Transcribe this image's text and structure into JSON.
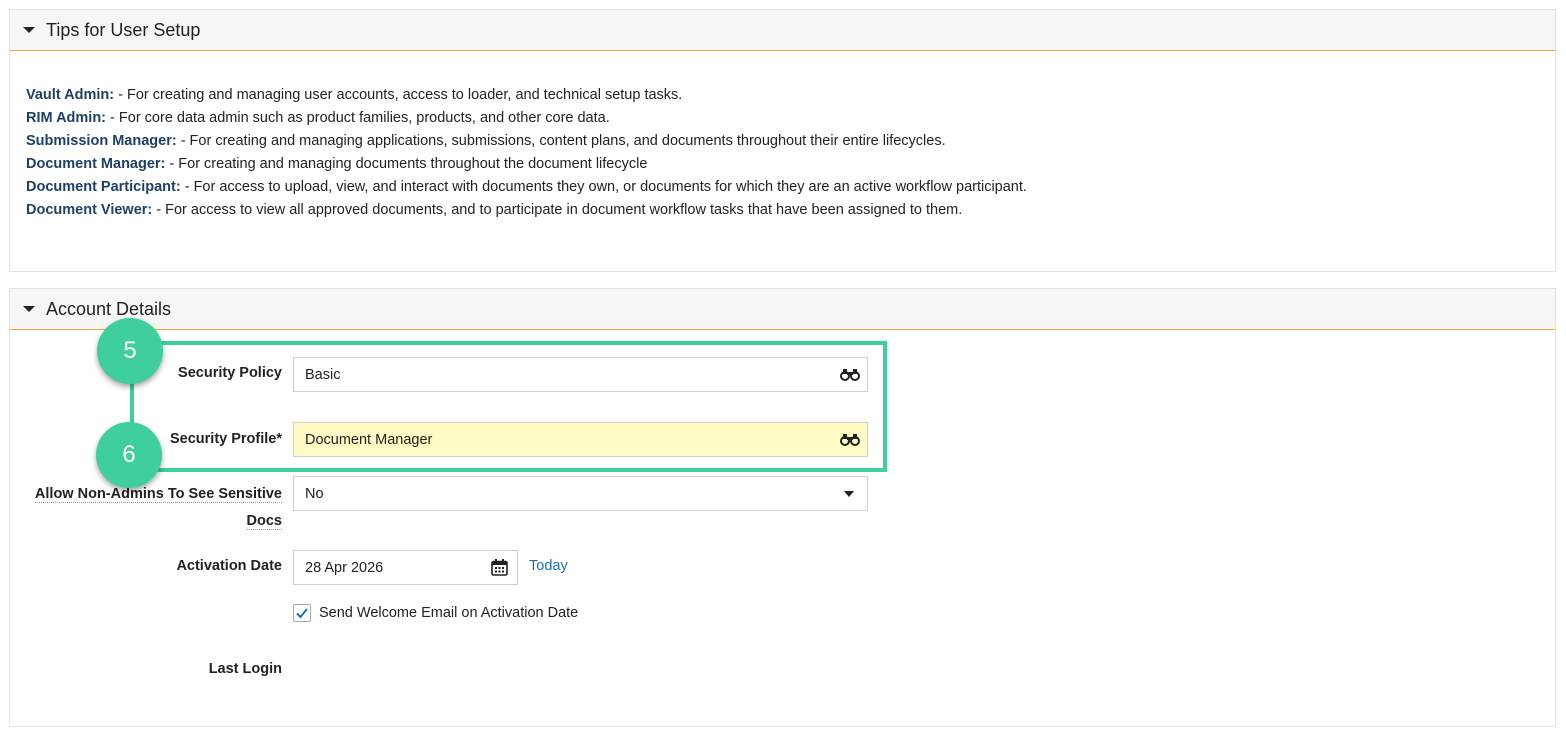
{
  "tips_panel": {
    "title": "Tips for User Setup",
    "lines": [
      {
        "role": "Vault Admin:",
        "text": " - For creating and managing user accounts, access to loader, and technical setup tasks."
      },
      {
        "role": "RIM Admin:",
        "text": " - For core data admin such as product families, products, and other core data."
      },
      {
        "role": "Submission Manager:",
        "text": " - For creating and managing applications, submissions, content plans, and documents throughout their entire lifecycles."
      },
      {
        "role": "Document Manager:",
        "text": " - For creating and managing documents throughout the document lifecycle"
      },
      {
        "role": "Document Participant:",
        "text": " - For access to upload, view, and interact with documents they own, or documents for which they are an active workflow participant."
      },
      {
        "role": "Document Viewer:",
        "text": " - For access to view all approved documents, and to participate in document workflow tasks that have been assigned to them."
      }
    ]
  },
  "account_panel": {
    "title": "Account Details",
    "security_policy": {
      "label": "Security Policy",
      "value": "Basic"
    },
    "security_profile": {
      "label": "Security Profile*",
      "value": "Document Manager"
    },
    "sensitive_docs": {
      "label_line1": "Allow Non-Admins To See Sensitive",
      "label_line2": "Docs",
      "value": "No"
    },
    "activation_date": {
      "label": "Activation Date",
      "value": "28 Apr 2026",
      "today_link": "Today"
    },
    "welcome_email": {
      "label": "Send Welcome Email on Activation Date",
      "checked": true
    },
    "last_login": {
      "label": "Last Login",
      "value": ""
    }
  },
  "callouts": {
    "badge_1": "5",
    "badge_2": "6"
  },
  "colors": {
    "callout": "#3fcf9c",
    "header_rule": "#e8a34d",
    "role_text": "#1f3f66",
    "link": "#1e6fb5",
    "highlight_field": "#fefbc5"
  }
}
